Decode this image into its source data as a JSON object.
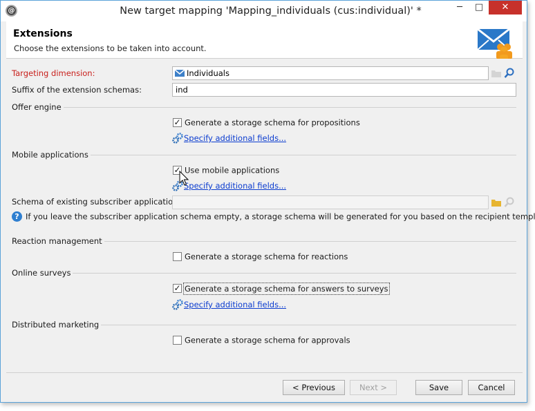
{
  "window": {
    "title": "New target mapping 'Mapping_individuals (cus:individual)' *",
    "min_symbol": "─",
    "max_symbol": "□",
    "close_symbol": "✕",
    "app_icon": "@"
  },
  "header": {
    "title": "Extensions",
    "subtitle": "Choose the extensions to be taken into account."
  },
  "targeting": {
    "label": "Targeting dimension:",
    "value": "Individuals"
  },
  "suffix": {
    "label": "Suffix of the extension schemas:",
    "value": "ind"
  },
  "offer_engine": {
    "label": "Offer engine",
    "checkbox_label": "Generate a storage schema for propositions",
    "checked": true,
    "link": "Specify additional fields..."
  },
  "mobile": {
    "label": "Mobile applications",
    "checkbox_label": "Use mobile applications",
    "checked": true,
    "link": "Specify additional fields...",
    "schema_label": "Schema of existing subscriber applications:",
    "schema_value": "",
    "info": "If you leave the subscriber application schema empty, a storage schema will be generated for you based on the recipient template."
  },
  "reaction": {
    "label": "Reaction management",
    "checkbox_label": "Generate a storage schema for reactions",
    "checked": false
  },
  "surveys": {
    "label": "Online surveys",
    "checkbox_label": "Generate a storage schema for answers to surveys",
    "checked": true,
    "link": "Specify additional fields..."
  },
  "distributed": {
    "label": "Distributed marketing",
    "checkbox_label": "Generate a storage schema for approvals",
    "checked": false
  },
  "buttons": {
    "previous": "< Previous",
    "next": "Next >",
    "save": "Save",
    "cancel": "Cancel"
  },
  "colors": {
    "required_label": "#c8201c",
    "link": "#0b3ccf",
    "close_button": "#c7312b",
    "window_border": "#5aa2d9"
  },
  "icons": [
    "app-icon",
    "extensions-envelope-icon",
    "dimension-icon",
    "folder-icon",
    "search-icon",
    "gear-icon",
    "help-icon",
    "mouse-cursor-icon"
  ]
}
